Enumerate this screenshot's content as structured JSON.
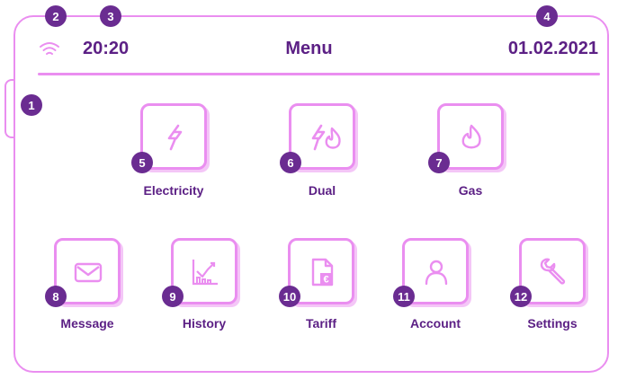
{
  "header": {
    "time": "20:20",
    "title": "Menu",
    "date": "01.02.2021",
    "wifi_icon": "wifi-icon"
  },
  "badges": [
    "1",
    "2",
    "3",
    "4",
    "5",
    "6",
    "7",
    "8",
    "9",
    "10",
    "11",
    "12"
  ],
  "menu": {
    "electricity": {
      "label": "Electricity",
      "icon": "lightning-icon"
    },
    "dual": {
      "label": "Dual",
      "icon": "lightning-flame-icon"
    },
    "gas": {
      "label": "Gas",
      "icon": "flame-icon"
    },
    "message": {
      "label": "Message",
      "icon": "envelope-icon"
    },
    "history": {
      "label": "History",
      "icon": "chart-icon"
    },
    "tariff": {
      "label": "Tariff",
      "icon": "euro-document-icon"
    },
    "account": {
      "label": "Account",
      "icon": "user-icon"
    },
    "settings": {
      "label": "Settings",
      "icon": "wrench-icon"
    }
  },
  "colors": {
    "accent": "#ea8ef0",
    "text": "#5c2085",
    "badge": "#6a2c91"
  }
}
